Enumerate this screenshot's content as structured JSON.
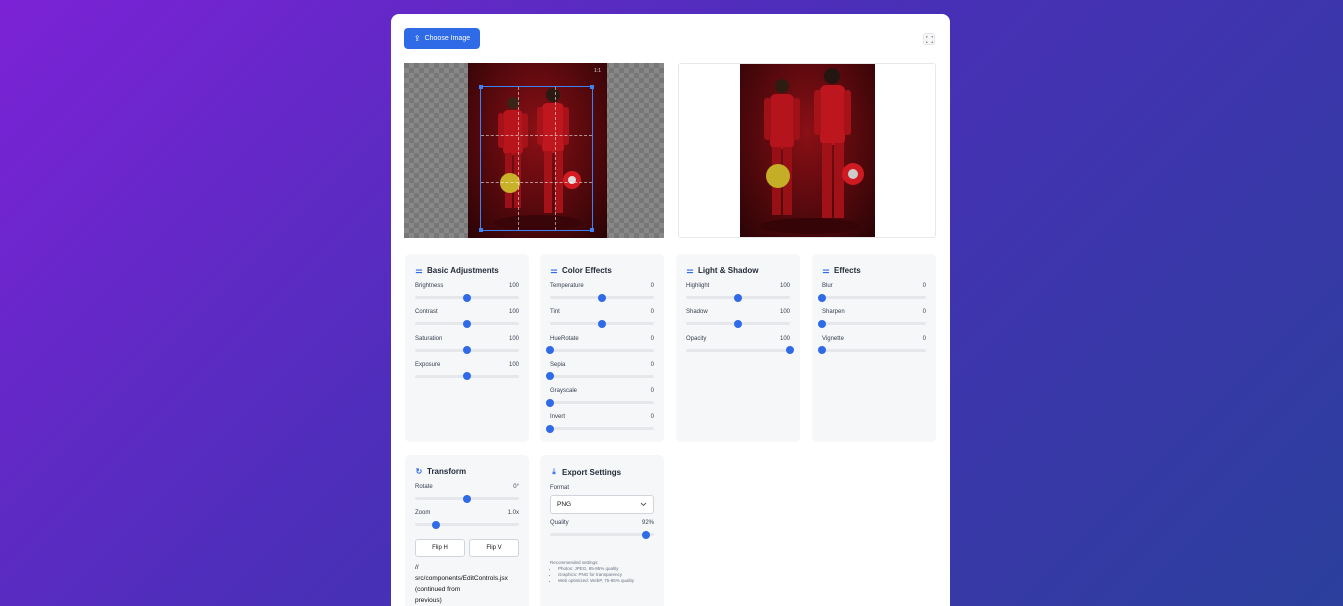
{
  "toolbar": {
    "choose_label": "Choose Image",
    "upload_icon": "upload-icon",
    "expand_icon": "expand-icon"
  },
  "preview": {
    "crop_ratio_label": "1:1"
  },
  "colors": {
    "accent": "#2f6be6",
    "panel_bg": "#f6f7f9",
    "photo_red": "#8a1016"
  },
  "panels": {
    "basic": {
      "title": "Basic Adjustments",
      "icon": "sliders-icon",
      "controls": [
        {
          "label": "Brightness",
          "value": "100",
          "fraction": 0.5
        },
        {
          "label": "Contrast",
          "value": "100",
          "fraction": 0.5
        },
        {
          "label": "Saturation",
          "value": "100",
          "fraction": 0.5
        },
        {
          "label": "Exposure",
          "value": "100",
          "fraction": 0.5
        }
      ]
    },
    "color": {
      "title": "Color Effects",
      "icon": "sliders-icon",
      "controls": [
        {
          "label": "Temperature",
          "value": "0",
          "fraction": 0.5
        },
        {
          "label": "Tint",
          "value": "0",
          "fraction": 0.5
        },
        {
          "label": "HueRotate",
          "value": "0",
          "fraction": 0
        },
        {
          "label": "Sepia",
          "value": "0",
          "fraction": 0
        },
        {
          "label": "Grayscale",
          "value": "0",
          "fraction": 0
        },
        {
          "label": "Invert",
          "value": "0",
          "fraction": 0
        }
      ]
    },
    "light": {
      "title": "Light & Shadow",
      "icon": "sliders-icon",
      "controls": [
        {
          "label": "Highlight",
          "value": "100",
          "fraction": 0.5
        },
        {
          "label": "Shadow",
          "value": "100",
          "fraction": 0.5
        },
        {
          "label": "Opacity",
          "value": "100",
          "fraction": 1
        }
      ]
    },
    "effects": {
      "title": "Effects",
      "icon": "sliders-icon",
      "controls": [
        {
          "label": "Blur",
          "value": "0",
          "fraction": 0
        },
        {
          "label": "Sharpen",
          "value": "0",
          "fraction": 0
        },
        {
          "label": "Vignette",
          "value": "0",
          "fraction": 0
        }
      ]
    },
    "transform": {
      "title": "Transform",
      "icon": "rotate-icon",
      "controls": [
        {
          "label": "Rotate",
          "value": "0°",
          "fraction": 0.5
        },
        {
          "label": "Zoom",
          "value": "1.0x",
          "fraction": 0.2
        }
      ],
      "flip_h": "Flip H",
      "flip_v": "Flip V",
      "code_note": [
        "//",
        "src/components/EditControls.jsx",
        "(continued from",
        "previous)"
      ]
    },
    "export": {
      "title": "Export Settings",
      "icon": "download-icon",
      "format_label": "Format",
      "format_value": "PNG",
      "quality_label": "Quality",
      "quality_value": "92%",
      "quality_fraction": 0.92,
      "recommended_title": "Recommended settings:",
      "recommended": [
        "Photos: JPEG, 85-95% quality",
        "Graphics: PNG for transparency",
        "Web optimized: WebP, 75-85% quality"
      ]
    }
  }
}
